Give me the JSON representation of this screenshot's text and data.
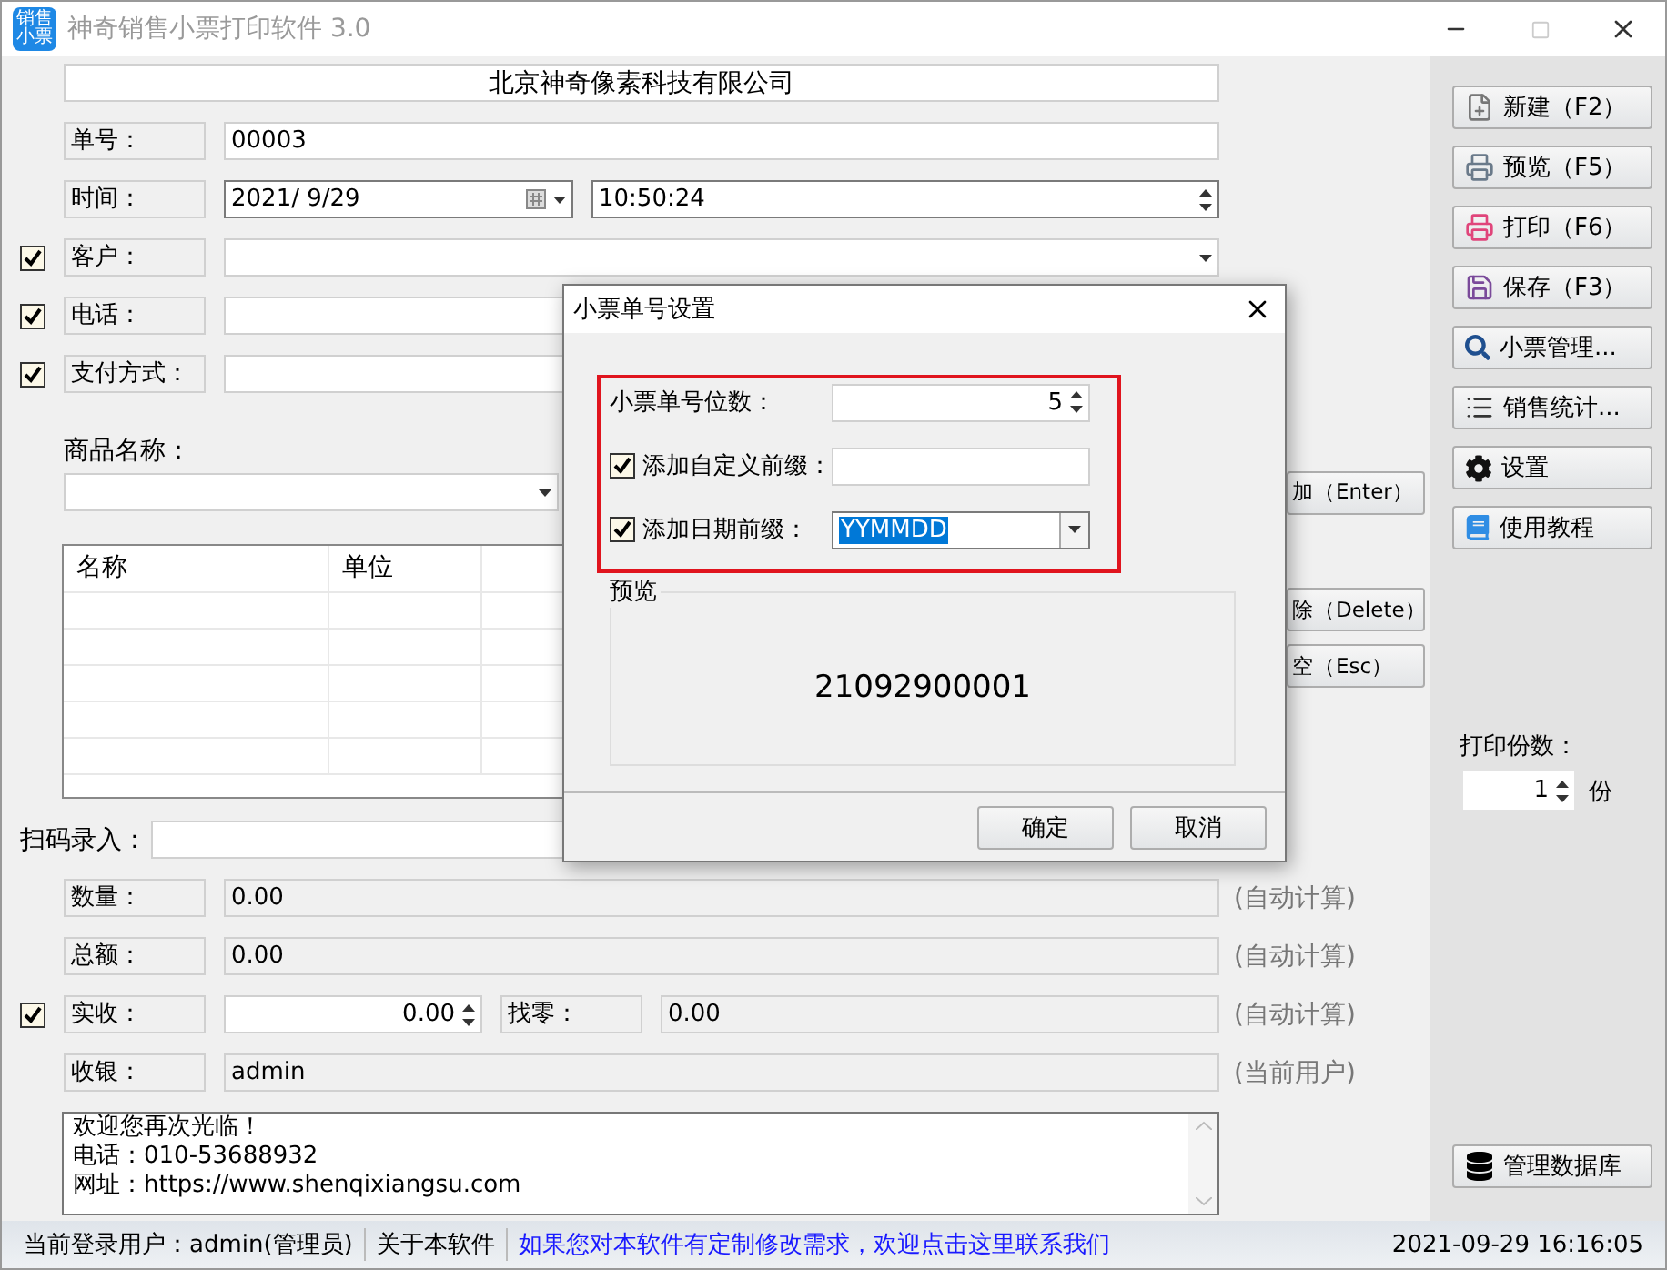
{
  "window": {
    "title": "神奇销售小票打印软件 3.0",
    "icon_text": "销售小票"
  },
  "header": {
    "company": "北京神奇像素科技有限公司"
  },
  "fields": [
    {
      "kind": "text",
      "label": "单号：",
      "value": "00003"
    },
    {
      "kind": "datetime",
      "label": "时间：",
      "date": "2021/  9/29",
      "time": "10:50:24"
    },
    {
      "kind": "combo",
      "label": "客户：",
      "checked": true
    },
    {
      "kind": "text",
      "label": "电话：",
      "checked": true
    },
    {
      "kind": "text",
      "label": "支付方式：",
      "checked": true
    }
  ],
  "product": {
    "label": "商品名称：",
    "add_button": "加（Enter）"
  },
  "table": {
    "columns": [
      "名称",
      "单位"
    ],
    "delete_button": "除（Delete）",
    "clear_button": "空（Esc）"
  },
  "scan": {
    "label": "扫码录入："
  },
  "totals": [
    {
      "kind": "readonly",
      "label": "数量：",
      "value": "0.00",
      "hint": "(自动计算)"
    },
    {
      "kind": "readonly",
      "label": "总额：",
      "value": "0.00",
      "hint": "(自动计算)"
    },
    {
      "kind": "payment",
      "label": "实收：",
      "checked": true,
      "value": "0.00",
      "change_label": "找零：",
      "change_value": "0.00",
      "hint": "(自动计算)"
    },
    {
      "kind": "readonly",
      "label": "收银：",
      "value": "admin",
      "hint": "(当前用户)"
    }
  ],
  "receipt_footer": [
    "欢迎您再次光临！",
    "电话：010-53688932",
    "网址：https://www.shenqixiangsu.com"
  ],
  "toolbar": [
    {
      "kind": "new",
      "label": "新建（F2）"
    },
    {
      "kind": "preview",
      "label": "预览（F5）"
    },
    {
      "kind": "print",
      "label": "打印（F6）"
    },
    {
      "kind": "save",
      "label": "保存（F3）"
    },
    {
      "kind": "search",
      "label": "小票管理..."
    },
    {
      "kind": "stats",
      "label": "销售统计..."
    },
    {
      "kind": "settings",
      "label": "设置"
    },
    {
      "kind": "tutorial",
      "label": "使用教程"
    }
  ],
  "copies": {
    "label": "打印份数：",
    "value": "1",
    "unit": "份"
  },
  "database_button": "管理数据库",
  "status_bar": {
    "user": "当前登录用户：admin(管理员)",
    "about": "关于本软件",
    "contact": "如果您对本软件有定制修改需求，欢迎点击这里联系我们",
    "datetime": "2021-09-29 16:16:05"
  },
  "dialog": {
    "title": "小票单号设置",
    "rows": [
      {
        "kind": "spin",
        "label": "小票单号位数：",
        "value": "5"
      },
      {
        "kind": "text",
        "label": "添加自定义前缀：",
        "checked": true
      },
      {
        "kind": "combo",
        "label": "添加日期前缀：",
        "checked": true,
        "value": "YYMMDD"
      }
    ],
    "preview_title": "预览",
    "preview_value": "21092900001",
    "buttons": [
      "确定",
      "取消"
    ]
  }
}
